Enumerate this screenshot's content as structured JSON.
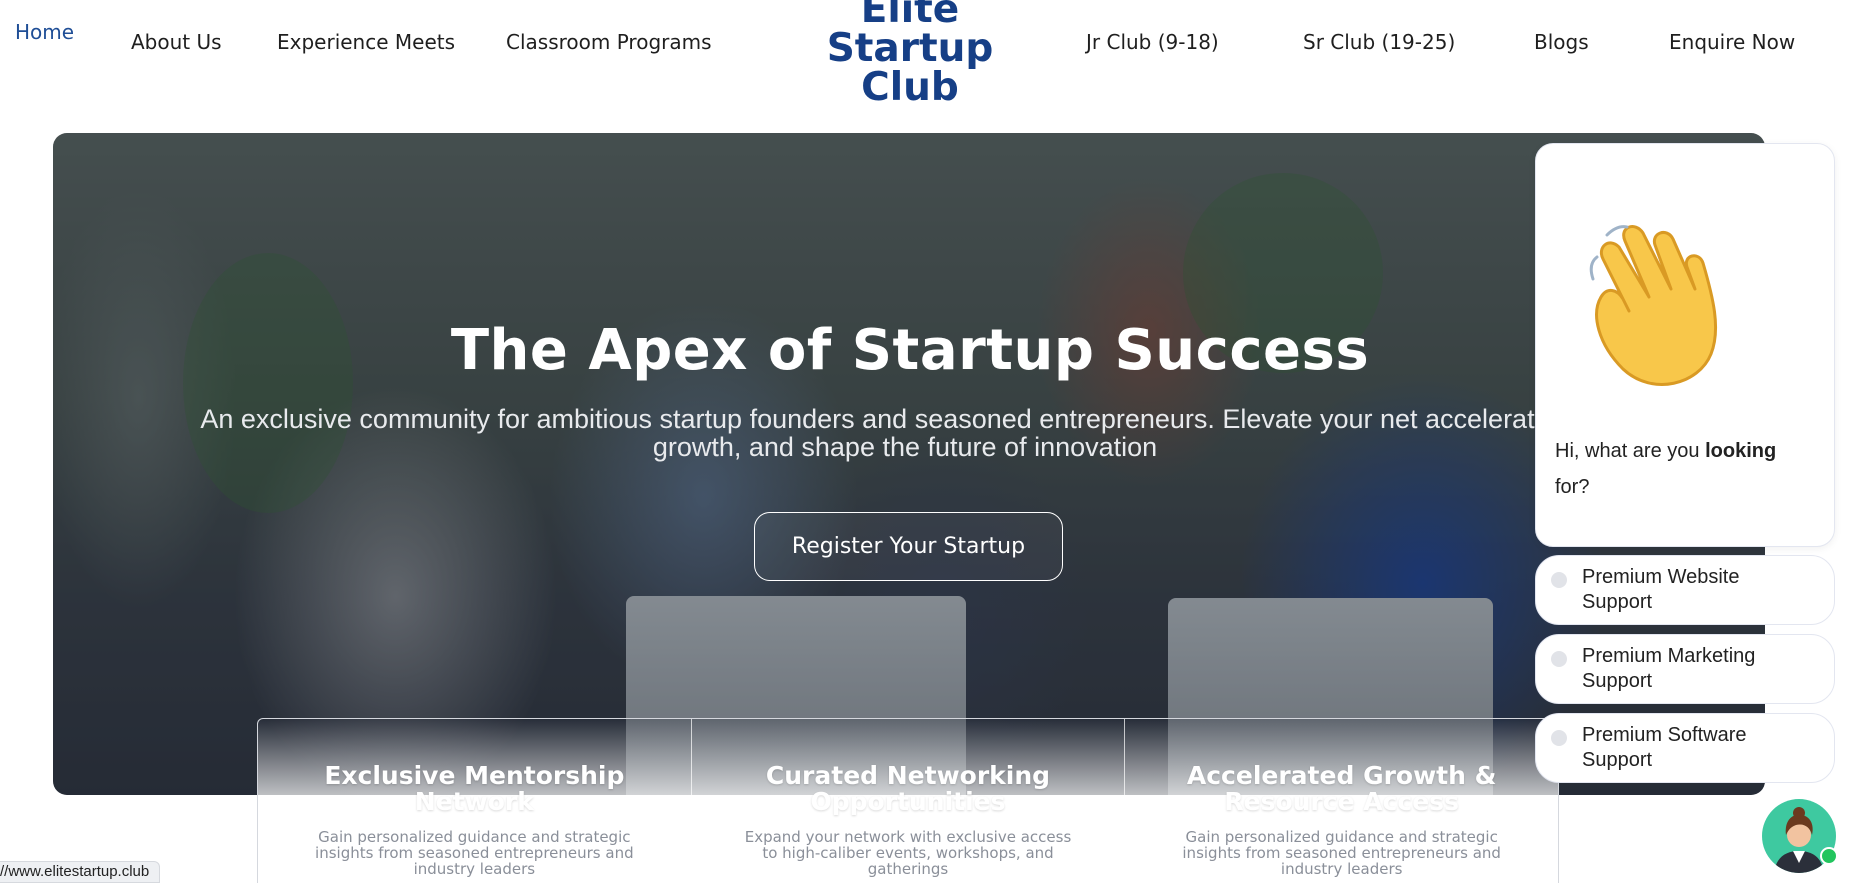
{
  "nav": {
    "left_links": [
      "Home",
      "About Us",
      "Experience Meets",
      "Classroom Programs"
    ],
    "logo_lines": [
      "Elite",
      "Startup",
      "Club"
    ],
    "right_links": [
      "Jr Club (9-18)",
      "Sr Club (19-25)",
      "Blogs",
      "Enquire Now"
    ]
  },
  "hero": {
    "title": "The Apex of Startup Success",
    "subtitle": "An exclusive community for ambitious startup founders and seasoned entrepreneurs. Elevate your net accelerate your growth, and shape the future of innovation",
    "cta_label": "Register Your Startup"
  },
  "features": [
    {
      "title": "Exclusive Mentorship Network",
      "desc": "Gain personalized guidance and strategic insights from seasoned entrepreneurs and industry leaders"
    },
    {
      "title": "Curated Networking Opportunities",
      "desc": "Expand your network with exclusive access to high-caliber events, workshops, and gatherings"
    },
    {
      "title": "Accelerated Growth & Resource Access",
      "desc": "Gain personalized guidance and strategic insights from seasoned entrepreneurs and industry leaders"
    }
  ],
  "chat": {
    "greeting_before": "Hi, what are you ",
    "greeting_bold": "looking",
    "greeting_after": " for?",
    "wave_icon": "waving-hand-icon",
    "options": [
      "Premium Website Support",
      "Premium Marketing Support",
      "Premium Software Support"
    ]
  },
  "status_url": "//www.elitestartup.club",
  "colors": {
    "brand": "#163f86",
    "active_link": "#1f4e96",
    "online": "#22c55e",
    "avatar_bg": "#3ec9a0"
  }
}
